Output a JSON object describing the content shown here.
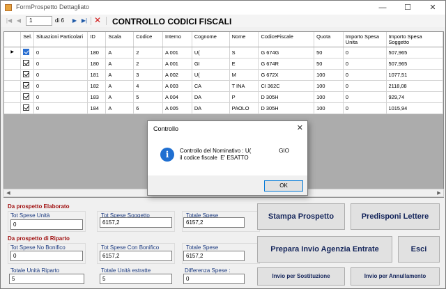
{
  "window": {
    "title": "FormProspetto Dettagliato",
    "minimize": "—",
    "maximize": "☐",
    "close": "✕"
  },
  "navigator": {
    "position": "1",
    "of_label": "di 6",
    "form_title": "CONTROLLO CODICI FISCALI"
  },
  "grid": {
    "columns": [
      "",
      "Sel.",
      "Situazioni Particolari",
      "ID",
      "Scala",
      "Codice",
      "Interno",
      "Cognome",
      "Nome",
      "CodiceFiscale",
      "Quota",
      "Importo Spesa Unita",
      "Importo Spesa Soggetto"
    ],
    "rows": [
      {
        "marker": "▶",
        "sel": true,
        "situazioni": "0",
        "id": "180",
        "scala": "A",
        "codice": "2",
        "interno": "A 001",
        "cognome": "U(",
        "nome": "S",
        "cf": "G                674G",
        "quota": "50",
        "isu": "0",
        "iss": "507,965"
      },
      {
        "marker": "",
        "sel": true,
        "situazioni": "0",
        "id": "180",
        "scala": "A",
        "codice": "2",
        "interno": "A 001",
        "cognome": "GI",
        "nome": "E",
        "cf": "G                674R",
        "quota": "50",
        "isu": "0",
        "iss": "507,965"
      },
      {
        "marker": "",
        "sel": true,
        "situazioni": "0",
        "id": "181",
        "scala": "A",
        "codice": "3",
        "interno": "A 002",
        "cognome": "U(",
        "nome": "M",
        "cf": "G                672X",
        "quota": "100",
        "isu": "0",
        "iss": "1077,51"
      },
      {
        "marker": "",
        "sel": true,
        "situazioni": "0",
        "id": "182",
        "scala": "A",
        "codice": "4",
        "interno": "A 003",
        "cognome": "CA",
        "nome": "T         INA",
        "cf": "CI               362C",
        "quota": "100",
        "isu": "0",
        "iss": "2118,08"
      },
      {
        "marker": "",
        "sel": true,
        "situazioni": "0",
        "id": "183",
        "scala": "A",
        "codice": "5",
        "interno": "A 004",
        "cognome": "DA",
        "nome": "P",
        "cf": "D                305H",
        "quota": "100",
        "isu": "0",
        "iss": "929,74"
      },
      {
        "marker": "",
        "sel": true,
        "situazioni": "0",
        "id": "184",
        "scala": "A",
        "codice": "6",
        "interno": "A 005",
        "cognome": "DA",
        "nome": "PAOLO",
        "cf": "D                305H",
        "quota": "100",
        "isu": "0",
        "iss": "1015,94"
      }
    ]
  },
  "elaborato": {
    "heading": "Da prospetto Elaborato",
    "tot_spese_unita_label": "Tot Spese Unità",
    "tot_spese_unita": "0",
    "tot_spese_soggetto_label": "Tot Spese Soggetto",
    "tot_spese_soggetto": "6157,2",
    "totale_spese_label": "Totale Spese",
    "totale_spese": "6157,2"
  },
  "riparto": {
    "heading": "Da prospetto di Riparto",
    "no_bonifico_label": "Tot Spese No Bonifico",
    "no_bonifico": "0",
    "con_bonifico_label": "Tot Spese Con Bonifico",
    "con_bonifico": "6157,2",
    "totale_spese_label": "Totale Spese",
    "totale_spese": "6157,2",
    "totale_unita_riparto_label": "Totale Unità Riparto",
    "totale_unita_riparto": "5",
    "totale_unita_estratte_label": "Totale Unità estratte",
    "totale_unita_estratte": "5",
    "differenza_label": "Differenza Spese :",
    "differenza": "0"
  },
  "buttons": {
    "stampa": "Stampa Prospetto",
    "predisponi": "Predisponi Lettere",
    "prepara": "Prepara Invio Agenzia Entrate",
    "esci": "Esci",
    "sostituzione": "Invio per Sostituzione",
    "annullamento": "Invio per Annullamento"
  },
  "dialog": {
    "title": "Controllo",
    "message": "Controllo del Nominativo : U(                  GIO\nil codice fiscale  E' ESATTO",
    "ok": "OK",
    "close": "✕",
    "info": "i"
  }
}
